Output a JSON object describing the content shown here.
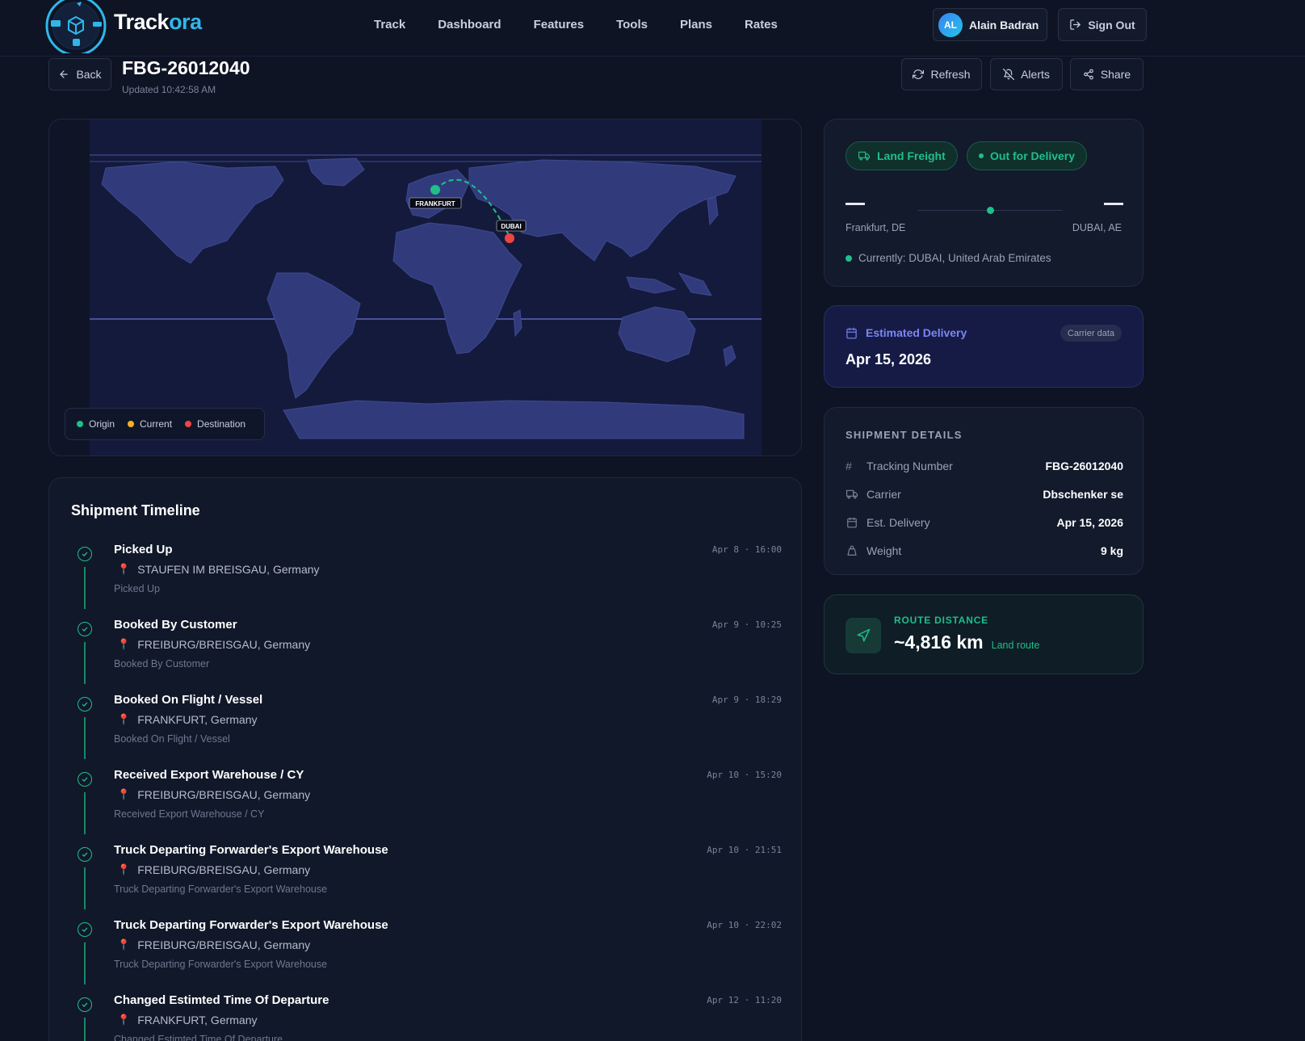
{
  "brand": {
    "name_part1": "Track",
    "name_part2": "ora",
    "accent": "#2fb7ea"
  },
  "nav": {
    "links": [
      "Track",
      "Dashboard",
      "Features",
      "Tools",
      "Plans",
      "Rates"
    ]
  },
  "user": {
    "initials": "AL",
    "name": "Alain Badran",
    "signout_label": "Sign Out"
  },
  "header": {
    "back_label": "Back",
    "shipment_id": "FBG-26012040",
    "updated": "Updated 10:42:58 AM",
    "refresh_label": "Refresh",
    "alerts_label": "Alerts",
    "share_label": "Share"
  },
  "map": {
    "origin_label": "FRANKFURT",
    "destination_label": "DUBAI",
    "legend": {
      "origin": "Origin",
      "current": "Current",
      "destination": "Destination"
    },
    "colors": {
      "origin": "#1fbf8a",
      "current": "#f5b125",
      "destination": "#ef4444",
      "route": "#1fbf8a"
    }
  },
  "timeline": {
    "title": "Shipment Timeline",
    "events": [
      {
        "name": "Picked Up",
        "location": "STAUFEN IM BREISGAU, Germany",
        "description": "Picked Up",
        "time": "Apr 8 · 16:00"
      },
      {
        "name": "Booked By Customer",
        "location": "FREIBURG/BREISGAU, Germany",
        "description": "Booked By Customer",
        "time": "Apr 9 · 10:25"
      },
      {
        "name": "Booked On Flight / Vessel",
        "location": "FRANKFURT, Germany",
        "description": "Booked On Flight / Vessel",
        "time": "Apr 9 · 18:29"
      },
      {
        "name": "Received Export Warehouse / CY",
        "location": "FREIBURG/BREISGAU, Germany",
        "description": "Received Export Warehouse / CY",
        "time": "Apr 10 · 15:20"
      },
      {
        "name": "Truck Departing Forwarder's Export Warehouse",
        "location": "FREIBURG/BREISGAU, Germany",
        "description": "Truck Departing Forwarder's Export Warehouse",
        "time": "Apr 10 · 21:51"
      },
      {
        "name": "Truck Departing Forwarder's Export Warehouse",
        "location": "FREIBURG/BREISGAU, Germany",
        "description": "Truck Departing Forwarder's Export Warehouse",
        "time": "Apr 10 · 22:02"
      },
      {
        "name": "Changed Estimted Time Of Departure",
        "location": "FRANKFURT, Germany",
        "description": "Changed Estimted Time Of Departure",
        "time": "Apr 12 · 11:20"
      }
    ]
  },
  "status": {
    "mode_label": "Land Freight",
    "status_label": "Out for Delivery",
    "origin": "Frankfurt, DE",
    "destination": "DUBAI, AE",
    "progress": 0.5,
    "current_location": "Currently: DUBAI, United Arab Emirates"
  },
  "estimated": {
    "title": "Estimated Delivery",
    "badge": "Carrier data",
    "date": "Apr 15, 2026"
  },
  "details": {
    "title": "SHIPMENT DETAILS",
    "rows": [
      {
        "label": "Tracking Number",
        "value": "FBG-26012040",
        "icon": "hash-icon"
      },
      {
        "label": "Carrier",
        "value": "Dbschenker se",
        "icon": "truck-icon"
      },
      {
        "label": "Est. Delivery",
        "value": "Apr 15, 2026",
        "icon": "calendar-icon"
      },
      {
        "label": "Weight",
        "value": "9 kg",
        "icon": "weight-icon"
      }
    ]
  },
  "distance": {
    "title": "ROUTE DISTANCE",
    "value": "~4,816 km",
    "mode": "Land route"
  }
}
